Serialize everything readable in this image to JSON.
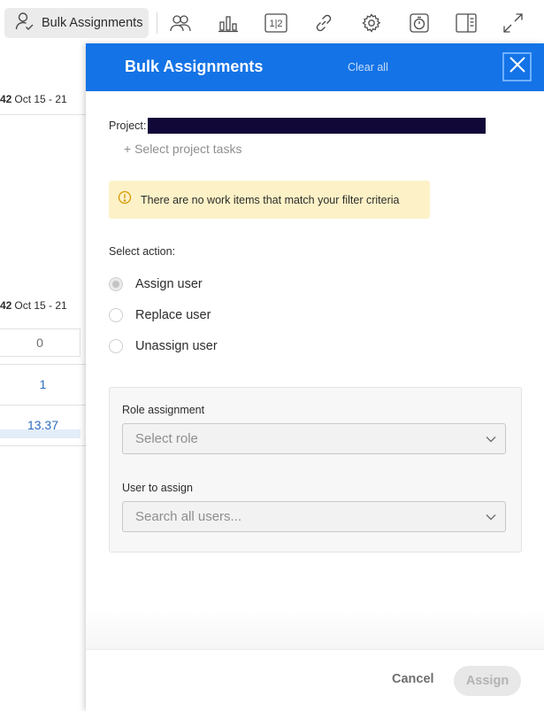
{
  "toolbar": {
    "bulk_assignments_label": "Bulk Assignments",
    "icons": [
      "user-check-icon",
      "team-icon",
      "bar-chart-icon",
      "page-split-icon",
      "link-icon",
      "gear-icon",
      "timer-icon",
      "side-panel-icon",
      "expand-icon"
    ],
    "page_split_text": "1|2"
  },
  "background": {
    "header_1": {
      "bold": "42",
      "text": "Oct 15 - 21"
    },
    "header_2": {
      "bold": "42",
      "text": "Oct 15 - 21"
    },
    "cells": [
      "0",
      "1",
      "13.37"
    ]
  },
  "panel": {
    "title": "Bulk Assignments",
    "clear_all": "Clear all",
    "close_icon": "close-icon",
    "project_label": "Project:",
    "select_tasks": "+ Select project tasks",
    "warning_text": "There are no work items that match your filter criteria",
    "action_label": "Select action:",
    "actions": [
      {
        "label": "Assign user",
        "checked": true
      },
      {
        "label": "Replace user",
        "checked": false
      },
      {
        "label": "Unassign user",
        "checked": false
      }
    ],
    "role_label": "Role assignment",
    "role_placeholder": "Select role",
    "user_label": "User to assign",
    "user_placeholder": "Search all users...",
    "cancel": "Cancel",
    "assign": "Assign"
  },
  "colors": {
    "header_blue": "#1473e6",
    "warning_bg": "#fdf2c7",
    "link_blue": "#2b6cbf"
  }
}
